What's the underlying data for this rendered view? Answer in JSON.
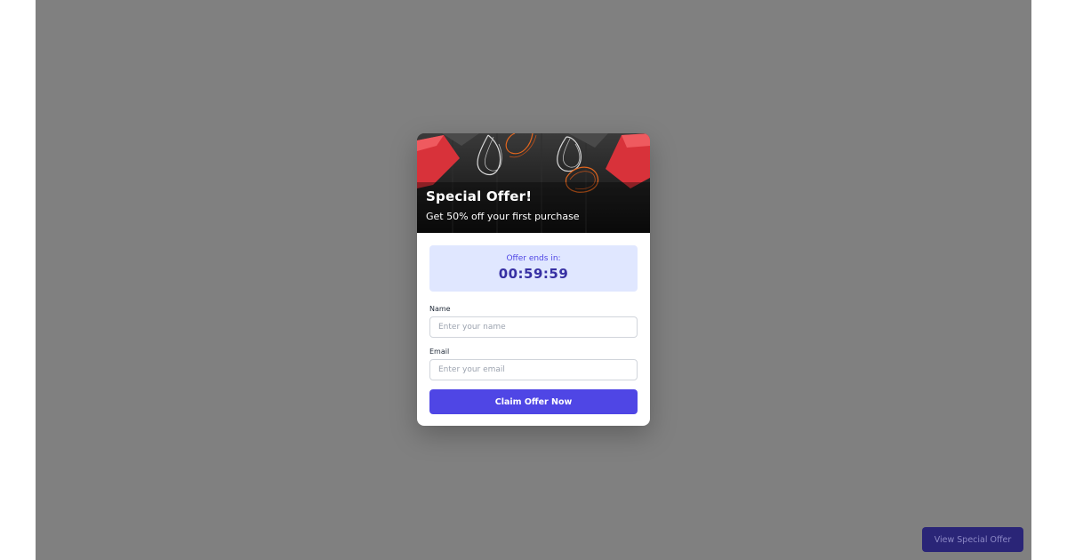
{
  "popup": {
    "title": "Special Offer!",
    "subtitle": "Get 50% off your first purchase",
    "timer_label": "Offer ends in:",
    "timer_value": "00:59:59",
    "name_label": "Name",
    "name_placeholder": "Enter your name",
    "email_label": "Email",
    "email_placeholder": "Enter your email",
    "claim_label": "Claim Offer Now"
  },
  "page": {
    "view_offer_label": "View Special Offer"
  },
  "colors": {
    "overlay": "#808080",
    "accent": "#4f46e5",
    "timer_bg": "#e0e7ff",
    "timer_text": "#3730a3",
    "bag_red": "#e5393f"
  },
  "icons": {
    "hero_image": "shopping-bags-image"
  }
}
